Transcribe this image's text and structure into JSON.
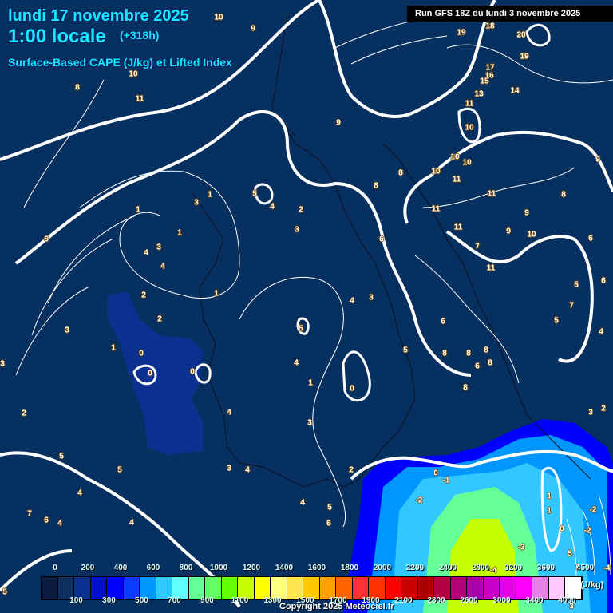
{
  "header": {
    "date": "lundi 17 novembre 2025",
    "time": "1:00 locale",
    "lead": "(+318h)",
    "parameter": "Surface-Based CAPE (J/kg) et Lifted Index",
    "run": "Run GFS 18Z du lundi 3 novembre 2025"
  },
  "colors": {
    "background": "#06305f",
    "title": "#19e6ff",
    "contour": "#ffffff"
  },
  "contour_labels": [
    "10",
    "9",
    "10",
    "8",
    "11",
    "9",
    "8",
    "10",
    "10",
    "10",
    "11",
    "8",
    "1",
    "3",
    "5",
    "4",
    "2",
    "1",
    "1",
    "3",
    "6",
    "6",
    "4",
    "3",
    "4",
    "1",
    "2",
    "4",
    "3",
    "2",
    "5",
    "3",
    "1",
    "0",
    "0",
    "0",
    "5",
    "4",
    "1",
    "0",
    "4",
    "2",
    "3",
    "3",
    "5",
    "5",
    "3",
    "4",
    "4",
    "7",
    "6",
    "4",
    "4",
    "4",
    "5",
    "6",
    "2",
    "-2",
    "0",
    "-1",
    "19",
    "18",
    "20",
    "19",
    "17",
    "16",
    "15",
    "13",
    "14",
    "11",
    "10",
    "11",
    "11",
    "11",
    "9",
    "9",
    "10",
    "8",
    "9",
    "6",
    "7",
    "11",
    "5",
    "6",
    "7",
    "5",
    "4",
    "6",
    "8",
    "8",
    "8",
    "6",
    "8",
    "8",
    "3",
    "2",
    "1",
    "1",
    "0",
    "-2",
    "-2",
    "-3",
    "5",
    "6",
    "3",
    "5",
    "-4",
    "-4"
  ],
  "legend": {
    "unit": "(J/kg)",
    "colors": [
      "#0a1a40",
      "#0d3060",
      "#0a3090",
      "#0010c8",
      "#0000ff",
      "#0a3cff",
      "#0096ff",
      "#32c8ff",
      "#64ffff",
      "#64ff96",
      "#64ff64",
      "#64ff00",
      "#c8ff00",
      "#ffff00",
      "#ffff80",
      "#ffe650",
      "#ffc800",
      "#ffa000",
      "#ff6400",
      "#ff3232",
      "#ff3200",
      "#ff0000",
      "#c80000",
      "#aa0000",
      "#b40040",
      "#b40078",
      "#aa00aa",
      "#c800c8",
      "#e600e6",
      "#ff00ff",
      "#e680e6",
      "#ffc8ff",
      "#ffffff"
    ],
    "top_ticks": [
      "0",
      "200",
      "400",
      "600",
      "800",
      "1000",
      "1200",
      "1400",
      "1600",
      "1800",
      "2000",
      "2200",
      "2400",
      "2800",
      "3200",
      "3600",
      "4500"
    ],
    "bottom_ticks": [
      "100",
      "300",
      "500",
      "700",
      "900",
      "1100",
      "1300",
      "1500",
      "1700",
      "1900",
      "2100",
      "2300",
      "2600",
      "3000",
      "3400",
      "4000"
    ]
  },
  "footer": {
    "copyright": "Copyright 2025 Meteociel.fr"
  }
}
